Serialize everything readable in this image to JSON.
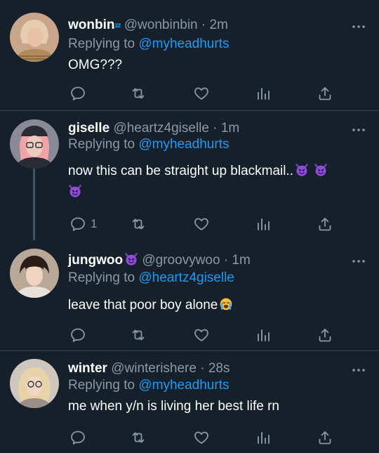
{
  "tweets": [
    {
      "name": "wonbin",
      "name_suffix": "zz",
      "handle": "@wonbinbin",
      "time": "· 2m",
      "reply_prefix": "Replying to",
      "reply_to": "@myheadhurts",
      "text": "OMG???",
      "replies": "",
      "avatar_colors": {
        "bg": "#c9a58a",
        "hair": "#e6cdb2",
        "face": "#e9c2a6",
        "shirt": "#b08a5a"
      }
    },
    {
      "name": "giselle",
      "handle": "@heartz4giselle",
      "time": "· 1m",
      "reply_prefix": "Replying to",
      "reply_to": "@myheadhurts",
      "text": "now this can be straight up blackmail..",
      "replies": "1",
      "avatar_colors": {
        "bg": "#8a8a96",
        "hair": "#f2a3a8",
        "face": "#eccbc0",
        "shirt": "#2b2b33"
      }
    },
    {
      "name": "jungwoo",
      "handle": "@groovywoo",
      "time": "· 1m",
      "reply_prefix": "Replying to",
      "reply_to": "@heartz4giselle",
      "text": "leave that poor boy alone",
      "replies": "",
      "avatar_colors": {
        "bg": "#b9a898",
        "hair": "#2a1d18",
        "face": "#f0d4c2",
        "shirt": "#e8e2da"
      }
    },
    {
      "name": "winter",
      "handle": "@winterishere",
      "time": "· 28s",
      "reply_prefix": "Replying to",
      "reply_to": "@myheadhurts",
      "text": "me when y/n is living her best life rn",
      "replies": "",
      "avatar_colors": {
        "bg": "#cfc6be",
        "hair": "#e8d2a8",
        "face": "#f1d6c6",
        "shirt": "#9a8f88"
      }
    }
  ],
  "icons": {
    "reply": "reply-icon",
    "retweet": "retweet-icon",
    "like": "heart-icon",
    "analytics": "analytics-icon",
    "share": "share-icon",
    "more": "more-icon",
    "devil": "smiling-devil-emoji",
    "crying": "loudly-crying-emoji",
    "sleep": "zzz-emoji"
  },
  "colors": {
    "background": "#15202b",
    "muted": "#8b98a5",
    "link": "#1d9bf0",
    "divider": "#38444d"
  }
}
